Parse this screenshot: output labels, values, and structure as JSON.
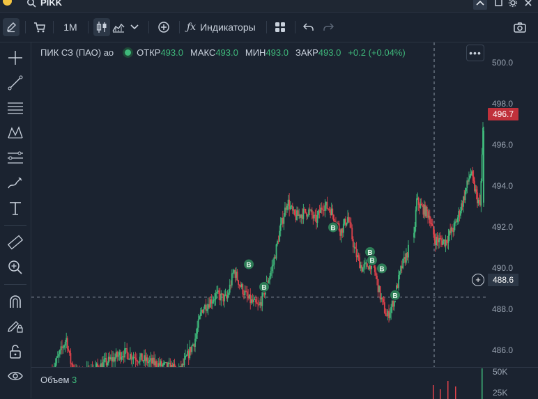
{
  "app": {
    "ticker": "PIKK"
  },
  "toolbar": {
    "interval": "1M",
    "indicators": "Индикаторы"
  },
  "legend": {
    "name": "ПИК СЗ (ПАО) ао",
    "open_label": "ОТКР",
    "open": "493.0",
    "high_label": "МАКС",
    "high": "493.0",
    "low_label": "МИН",
    "low": "493.0",
    "close_label": "ЗАКР",
    "close": "493.0",
    "change": "+0.2 (+0.04%)"
  },
  "price_axis": {
    "ticks": [
      "500.0",
      "498.0",
      "496.0",
      "494.0",
      "492.0",
      "490.0",
      "488.0",
      "486.0"
    ]
  },
  "last_price": "496.7",
  "crosshair_price": "488.6",
  "volume_pane": {
    "label": "Объем",
    "value": "3",
    "ticks": [
      "50K",
      "25K"
    ]
  },
  "trade_markers": {
    "label": "B"
  },
  "colors": {
    "up": "#3fb97b",
    "down": "#e0424b",
    "background": "#1b2330",
    "last_price_tag": "#c0313b"
  },
  "icons": [
    "search-icon",
    "pencil-icon",
    "cart-icon",
    "candles-icon",
    "area-chart-icon",
    "chevron-down-icon",
    "plus-circle-icon",
    "fx-icon",
    "grid-icon",
    "undo-icon",
    "redo-icon",
    "camera-icon",
    "crosshair-icon",
    "trend-line-icon",
    "horizontal-lines-icon",
    "pattern-icon",
    "fib-icon",
    "brush-icon",
    "text-icon",
    "ruler-icon",
    "zoom-icon",
    "magnet-icon",
    "lock-pencil-icon",
    "lock-icon",
    "eye-icon"
  ],
  "chart_data": {
    "type": "candlestick",
    "y_axis": {
      "range": [
        485.2,
        501.0
      ],
      "ticks": [
        500.0,
        498.0,
        496.0,
        494.0,
        492.0,
        490.0,
        488.0,
        486.0
      ]
    },
    "trend": [
      [
        0.0,
        485.0
      ],
      [
        0.04,
        486.6
      ],
      [
        0.05,
        485.5
      ],
      [
        0.07,
        484.8
      ],
      [
        0.12,
        485.1
      ],
      [
        0.2,
        485.9
      ],
      [
        0.28,
        485.4
      ],
      [
        0.36,
        485.0
      ],
      [
        0.4,
        486.5
      ],
      [
        0.42,
        488.0
      ],
      [
        0.46,
        488.7
      ],
      [
        0.49,
        488.5
      ],
      [
        0.51,
        489.9
      ],
      [
        0.53,
        489.1
      ],
      [
        0.55,
        488.5
      ],
      [
        0.58,
        488.1
      ],
      [
        0.6,
        489.1
      ],
      [
        0.62,
        490.2
      ],
      [
        0.64,
        491.9
      ],
      [
        0.66,
        493.3
      ],
      [
        0.68,
        492.5
      ],
      [
        0.72,
        492.8
      ],
      [
        0.74,
        492.3
      ],
      [
        0.76,
        493.1
      ],
      [
        0.78,
        492.9
      ],
      [
        0.81,
        491.8
      ],
      [
        0.83,
        492.5
      ],
      [
        0.85,
        490.8
      ],
      [
        0.87,
        490.0
      ],
      [
        0.9,
        490.3
      ],
      [
        0.92,
        488.7
      ],
      [
        0.94,
        487.6
      ],
      [
        0.96,
        488.5
      ],
      [
        0.98,
        490.0
      ],
      [
        1.0,
        490.9
      ]
    ],
    "trend_tail": [
      [
        0.0,
        491.5
      ],
      [
        0.04,
        493.3
      ],
      [
        0.1,
        493.0
      ],
      [
        0.22,
        492.6
      ],
      [
        0.3,
        491.4
      ],
      [
        0.45,
        491.3
      ],
      [
        0.6,
        492.1
      ],
      [
        0.72,
        493.4
      ],
      [
        0.82,
        494.7
      ],
      [
        0.9,
        493.6
      ],
      [
        0.96,
        493.0
      ],
      [
        1.0,
        496.7
      ]
    ],
    "buy_markers": [
      {
        "label": "B",
        "price": 490.2
      },
      {
        "label": "B",
        "price": 489.1
      },
      {
        "label": "B",
        "price": 492.0
      },
      {
        "label": "B",
        "price": 490.8
      },
      {
        "label": "B",
        "price": 490.4
      },
      {
        "label": "B",
        "price": 490.0
      },
      {
        "label": "B",
        "price": 488.7
      }
    ],
    "last_price": 496.7,
    "crosshair_price": 488.6
  }
}
